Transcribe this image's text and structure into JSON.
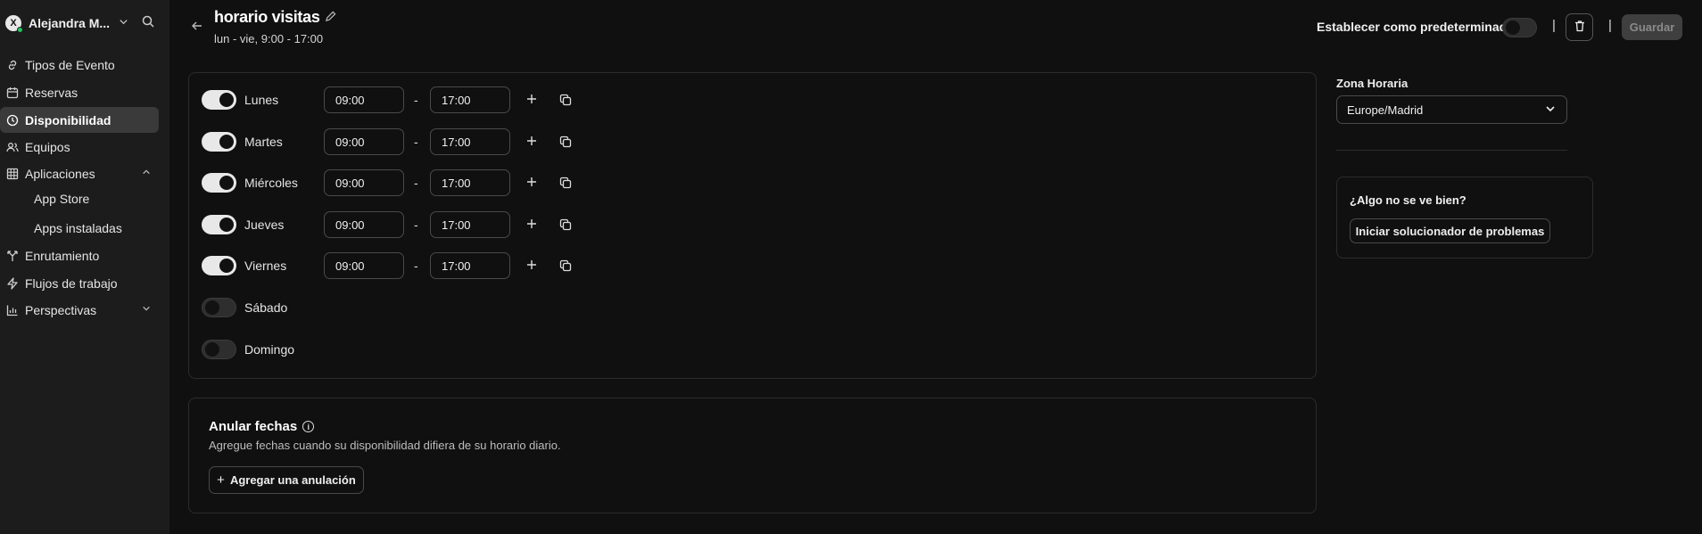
{
  "sidebar": {
    "user_name": "Alejandra M...",
    "avatar_initial": "X",
    "items": [
      {
        "label": "Tipos de Evento",
        "icon": "link-icon"
      },
      {
        "label": "Reservas",
        "icon": "calendar-icon"
      },
      {
        "label": "Disponibilidad",
        "icon": "clock-icon",
        "active": true
      },
      {
        "label": "Equipos",
        "icon": "users-icon"
      },
      {
        "label": "Aplicaciones",
        "icon": "grid-icon",
        "expanded": true
      },
      {
        "label": "Enrutamiento",
        "icon": "split-icon"
      },
      {
        "label": "Flujos de trabajo",
        "icon": "zap-icon"
      },
      {
        "label": "Perspectivas",
        "icon": "bar-chart-icon"
      }
    ],
    "subitems": [
      "App Store",
      "Apps instaladas"
    ]
  },
  "header": {
    "title": "horario visitas",
    "subtitle": "lun - vie, 9:00 - 17:00",
    "default_label": "Establecer como predeterminado",
    "save_label": "Guardar"
  },
  "schedule": {
    "days": [
      {
        "name": "Lunes",
        "enabled": true,
        "start": "09:00",
        "end": "17:00"
      },
      {
        "name": "Martes",
        "enabled": true,
        "start": "09:00",
        "end": "17:00"
      },
      {
        "name": "Miércoles",
        "enabled": true,
        "start": "09:00",
        "end": "17:00"
      },
      {
        "name": "Jueves",
        "enabled": true,
        "start": "09:00",
        "end": "17:00"
      },
      {
        "name": "Viernes",
        "enabled": true,
        "start": "09:00",
        "end": "17:00"
      },
      {
        "name": "Sábado",
        "enabled": false
      },
      {
        "name": "Domingo",
        "enabled": false
      }
    ],
    "separator": "-"
  },
  "timezone": {
    "label": "Zona Horaria",
    "value": "Europe/Madrid"
  },
  "help": {
    "title": "¿Algo no se ve bien?",
    "button": "Iniciar solucionador de problemas"
  },
  "overrides": {
    "title": "Anular fechas",
    "description": "Agregue fechas cuando su disponibilidad difiera de su horario diario.",
    "button": "Agregar una anulación"
  }
}
